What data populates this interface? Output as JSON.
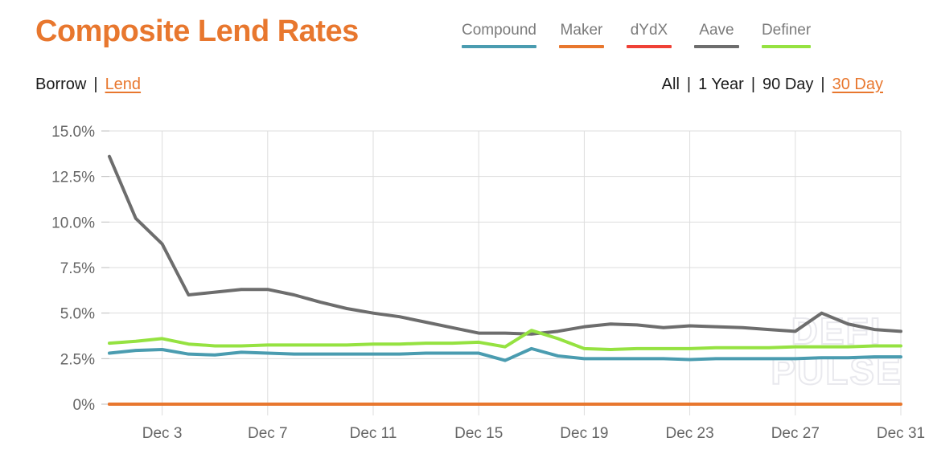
{
  "header": {
    "title": "Composite Lend Rates",
    "title_color": "#e8772e"
  },
  "legend": {
    "items": [
      {
        "label": "Compound",
        "color": "#4a9cb0"
      },
      {
        "label": "Maker",
        "color": "#e8772e"
      },
      {
        "label": "dYdX",
        "color": "#ef4136"
      },
      {
        "label": "Aave",
        "color": "#6d6d6d"
      },
      {
        "label": "Definer",
        "color": "#95e241"
      }
    ]
  },
  "filters": {
    "mode": {
      "options": [
        {
          "label": "Borrow",
          "active": false
        },
        {
          "label": "Lend",
          "active": true
        }
      ],
      "separator": "|"
    },
    "range": {
      "options": [
        {
          "label": "All",
          "active": false
        },
        {
          "label": "1 Year",
          "active": false
        },
        {
          "label": "90 Day",
          "active": false
        },
        {
          "label": "30 Day",
          "active": true
        }
      ],
      "separator": "|"
    }
  },
  "watermark": {
    "line1": "DEFI",
    "line2": "PULSE"
  },
  "chart_data": {
    "type": "line",
    "title": "Composite Lend Rates",
    "xlabel": "",
    "ylabel": "",
    "grid": true,
    "legend_position": "top-right",
    "x": [
      "Dec 1",
      "Dec 2",
      "Dec 3",
      "Dec 4",
      "Dec 5",
      "Dec 6",
      "Dec 7",
      "Dec 8",
      "Dec 9",
      "Dec 10",
      "Dec 11",
      "Dec 12",
      "Dec 13",
      "Dec 14",
      "Dec 15",
      "Dec 16",
      "Dec 17",
      "Dec 18",
      "Dec 19",
      "Dec 20",
      "Dec 21",
      "Dec 22",
      "Dec 23",
      "Dec 24",
      "Dec 25",
      "Dec 26",
      "Dec 27",
      "Dec 28",
      "Dec 29",
      "Dec 30",
      "Dec 31"
    ],
    "xtick_labels": [
      "Dec 3",
      "Dec 7",
      "Dec 11",
      "Dec 15",
      "Dec 19",
      "Dec 23",
      "Dec 27",
      "Dec 31"
    ],
    "xtick_indices": [
      2,
      6,
      10,
      14,
      18,
      22,
      26,
      30
    ],
    "ytick_labels": [
      "0%",
      "2.5%",
      "5.0%",
      "7.5%",
      "10.0%",
      "12.5%",
      "15.0%"
    ],
    "ytick_values": [
      0,
      2.5,
      5.0,
      7.5,
      10.0,
      12.5,
      15.0
    ],
    "ylim": [
      0,
      15
    ],
    "yunit": "%",
    "series": [
      {
        "name": "Aave",
        "color": "#6d6d6d",
        "values": [
          13.6,
          10.2,
          8.8,
          6.0,
          6.15,
          6.3,
          6.3,
          6.0,
          5.6,
          5.25,
          5.0,
          4.8,
          4.5,
          4.2,
          3.9,
          3.9,
          3.85,
          4.0,
          4.25,
          4.4,
          4.35,
          4.2,
          4.3,
          4.25,
          4.2,
          4.1,
          4.0,
          5.0,
          4.4,
          4.1,
          4.0
        ]
      },
      {
        "name": "Definer",
        "color": "#95e241",
        "values": [
          3.35,
          3.45,
          3.6,
          3.3,
          3.2,
          3.2,
          3.25,
          3.25,
          3.25,
          3.25,
          3.3,
          3.3,
          3.35,
          3.35,
          3.4,
          3.15,
          4.05,
          3.6,
          3.05,
          3.0,
          3.05,
          3.05,
          3.05,
          3.1,
          3.1,
          3.1,
          3.15,
          3.15,
          3.15,
          3.2,
          3.2
        ]
      },
      {
        "name": "Compound",
        "color": "#4a9cb0",
        "values": [
          2.8,
          2.95,
          3.0,
          2.75,
          2.7,
          2.85,
          2.8,
          2.75,
          2.75,
          2.75,
          2.75,
          2.75,
          2.8,
          2.8,
          2.8,
          2.4,
          3.05,
          2.65,
          2.5,
          2.5,
          2.5,
          2.5,
          2.45,
          2.5,
          2.5,
          2.5,
          2.5,
          2.55,
          2.55,
          2.6,
          2.6
        ]
      },
      {
        "name": "dYdX",
        "color": "#ef4136",
        "values": [
          0,
          0,
          0,
          0,
          0,
          0,
          0,
          0,
          0,
          0,
          0,
          0,
          0,
          0,
          0,
          0,
          0,
          0,
          0,
          0,
          0,
          0,
          0,
          0,
          0,
          0,
          0,
          0,
          0,
          0
        ]
      },
      {
        "name": "Maker",
        "color": "#e8772e",
        "values": [
          0,
          0,
          0,
          0,
          0,
          0,
          0,
          0,
          0,
          0,
          0,
          0,
          0,
          0,
          0,
          0,
          0,
          0,
          0,
          0,
          0,
          0,
          0,
          0,
          0,
          0,
          0,
          0,
          0,
          0,
          0
        ]
      }
    ]
  }
}
